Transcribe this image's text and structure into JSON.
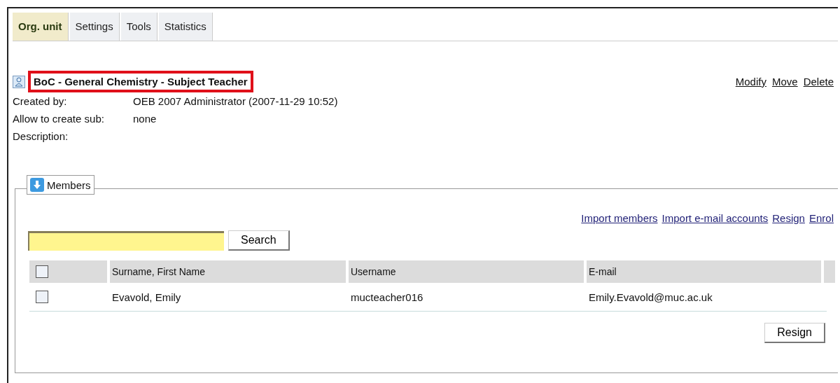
{
  "tabs": [
    {
      "label": "Org. unit",
      "selected": true
    },
    {
      "label": "Settings",
      "selected": false
    },
    {
      "label": "Tools",
      "selected": false
    },
    {
      "label": "Statistics",
      "selected": false
    }
  ],
  "unit": {
    "title": "BoC - General Chemistry - Subject Teacher",
    "highlighted": true,
    "actions": [
      "Modify",
      "Move",
      "Delete"
    ],
    "fields": [
      {
        "label": "Created by:",
        "value": "OEB 2007 Administrator (2007-11-29 10:52)"
      },
      {
        "label": "Allow to create sub:",
        "value": "none"
      },
      {
        "label": "Description:"
      }
    ]
  },
  "members": {
    "legend": "Members",
    "links": [
      "Import members",
      "Import e-mail accounts",
      "Resign",
      "Enrol"
    ],
    "search": {
      "button": "Search"
    },
    "table": {
      "columns": [
        "Surname, First Name",
        "Username",
        "E-mail"
      ],
      "all_checked": false,
      "rows": [
        {
          "checked": false,
          "cells": [
            "Evavold, Emily",
            "mucteacher016",
            "Emily.Evavold@muc.ac.uk"
          ]
        }
      ]
    },
    "button": "Resign"
  }
}
